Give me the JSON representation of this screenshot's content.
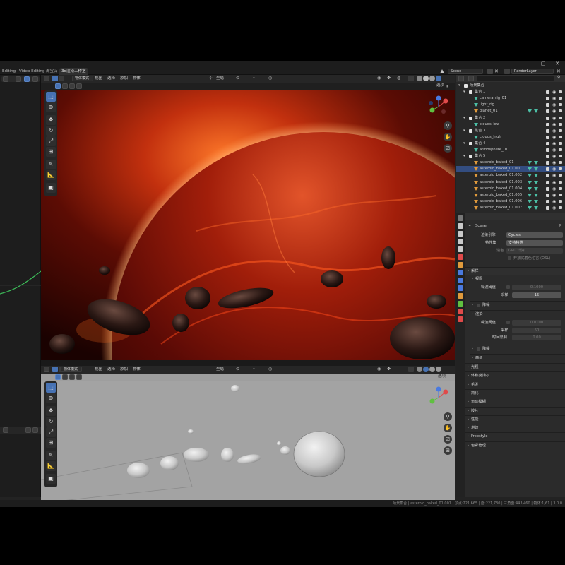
{
  "workspace_tabs": [
    "Editing",
    "Video Editing",
    "淘宝店",
    "3d渲染工作室"
  ],
  "active_tab_index": 3,
  "window_controls": [
    "–",
    "▢",
    "✕"
  ],
  "scene": {
    "label": "Scene",
    "render_layer": "RenderLayer"
  },
  "viewport_top": {
    "mode": "物体模式",
    "menus": [
      "视图",
      "选择",
      "添加",
      "物体"
    ],
    "transform": "全局",
    "options_label": "选项"
  },
  "viewport_bottom": {
    "mode": "物体模式",
    "menus": [
      "视图",
      "选择",
      "添加",
      "物体"
    ],
    "transform": "全局",
    "options_label": "选项"
  },
  "tools": [
    "select-box",
    "cursor",
    "move",
    "rotate",
    "scale",
    "transform",
    "annotate",
    "measure",
    "add-cube"
  ],
  "outliner": {
    "rows": [
      {
        "label": "场景集合",
        "type": "scene",
        "depth": 0
      },
      {
        "label": "集合 1",
        "type": "collection",
        "depth": 1
      },
      {
        "label": "camera_rig_01",
        "type": "object",
        "depth": 2
      },
      {
        "label": "light_rig",
        "type": "object",
        "depth": 2
      },
      {
        "label": "planet_01",
        "type": "mesh",
        "depth": 2
      },
      {
        "label": "集合 2",
        "type": "collection",
        "depth": 1
      },
      {
        "label": "clouds_low",
        "type": "object",
        "depth": 2
      },
      {
        "label": "集合 3",
        "type": "collection",
        "depth": 1
      },
      {
        "label": "clouds_high",
        "type": "object",
        "depth": 2
      },
      {
        "label": "集合 4",
        "type": "collection",
        "depth": 1
      },
      {
        "label": "atmosphere_01",
        "type": "object",
        "depth": 2
      },
      {
        "label": "集合 5",
        "type": "collection",
        "depth": 1
      },
      {
        "label": "asteroid_baked_01",
        "type": "mesh",
        "depth": 2
      },
      {
        "label": "asteroid_baked_01.001",
        "type": "mesh",
        "depth": 2,
        "selected": true
      },
      {
        "label": "asteroid_baked_01.002",
        "type": "mesh",
        "depth": 2
      },
      {
        "label": "asteroid_baked_01.003",
        "type": "mesh",
        "depth": 2
      },
      {
        "label": "asteroid_baked_01.004",
        "type": "mesh",
        "depth": 2
      },
      {
        "label": "asteroid_baked_01.005",
        "type": "mesh",
        "depth": 2
      },
      {
        "label": "asteroid_baked_01.006",
        "type": "mesh",
        "depth": 2
      },
      {
        "label": "asteroid_baked_01.007",
        "type": "mesh",
        "depth": 2
      }
    ]
  },
  "properties": {
    "breadcrumb": "Scene",
    "render_engine_label": "渲染引擎",
    "render_engine": "Cycles",
    "feature_set_label": "特性集",
    "feature_set": "支持特性",
    "device_label": "设备",
    "device": "GPU 计算",
    "osl_label": "开放式着色语言 (OSL)",
    "sampling_title": "采样",
    "viewport_title": "视图",
    "noise_threshold_label": "噪波阈值",
    "viewport_noise_threshold": "0.1000",
    "samples_label": "采样",
    "viewport_samples": "15",
    "denoise_title": "降噪",
    "render_title": "渲染",
    "render_noise_threshold": "0.0100",
    "render_samples": "50",
    "time_limit_label": "时间限制",
    "time_limit": "0.00",
    "advanced_title": "高级",
    "sections": [
      "光程",
      "体积(卷积)",
      "毛发",
      "简化",
      "运动模糊",
      "胶片",
      "性能",
      "烘焙",
      "Freestyle",
      "色彩管理"
    ]
  },
  "status_bar": "场景集合 | asteroid_baked_01.001 | 顶点:221,665 | 面:221,730 | 三角面:443,460 | 物体:1/61 | 3.0.0",
  "colors": {
    "accent": "#4772b3",
    "selection": "#334d80",
    "mesh_icon": "#e09a3c",
    "modifier_icon": "#4cbfa6"
  }
}
